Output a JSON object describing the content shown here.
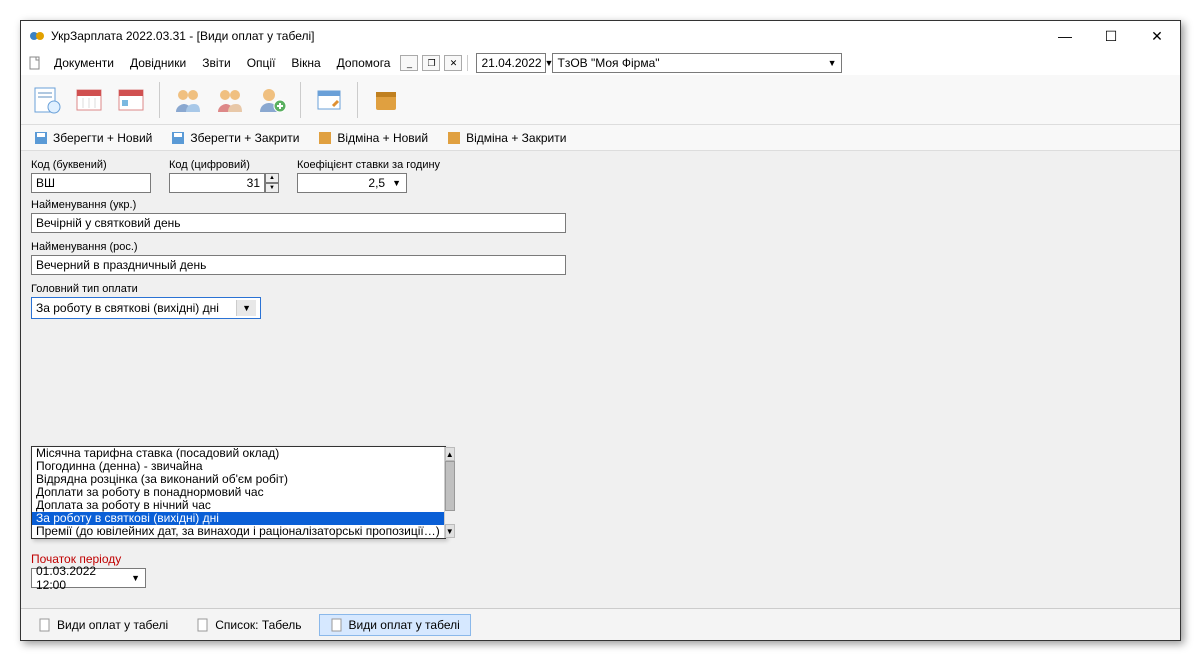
{
  "window": {
    "title": "УкрЗарплата 2022.03.31 - [Види оплат у табелі]"
  },
  "menubar": {
    "items": [
      "Документи",
      "Довідники",
      "Звіти",
      "Опції",
      "Вікна",
      "Допомога"
    ],
    "date": "21.04.2022",
    "firm": "ТзОВ \"Моя Фірма\""
  },
  "toolbar3": {
    "saveNew": "Зберегти + Новий",
    "saveClose": "Зберегти + Закрити",
    "cancelNew": "Відміна + Новий",
    "cancelClose": "Відміна + Закрити"
  },
  "fields": {
    "codeLetterLabel": "Код (буквений)",
    "codeLetterValue": "ВШ",
    "codeNumLabel": "Код (цифровий)",
    "codeNumValue": "31",
    "coefLabel": "Коефіцієнт ставки за годину",
    "coefValue": "2,5",
    "nameUkrLabel": "Найменування (укр.)",
    "nameUkrValue": "Вечірній у святковий день",
    "nameRusLabel": "Найменування (рос.)",
    "nameRusValue": "Вечерний в праздничный день",
    "mainTypeLabel": "Головний тип оплати",
    "mainTypeValue": "За роботу в святкові (вихідні) дні"
  },
  "dropdownList": {
    "items": [
      "Місячна тарифна ставка (посадовий оклад)",
      "Погодинна (денна) - звичайна",
      "Відрядна розцінка (за виконаний об'єм робіт)",
      "Доплати за роботу в понаднормовий час",
      "Доплата за роботу в нічний час",
      "За роботу в святкові (вихідні) дні",
      "Премії (до ювілейних дат, за винаходи і раціоналізаторські пропозиції…)"
    ],
    "selectedIndex": 5
  },
  "period": {
    "label": "Початок періоду",
    "value": "01.03.2022 12:00"
  },
  "tabs": {
    "t1": "Види оплат у табелі",
    "t2": "Список: Табель",
    "t3": "Види оплат у табелі"
  }
}
